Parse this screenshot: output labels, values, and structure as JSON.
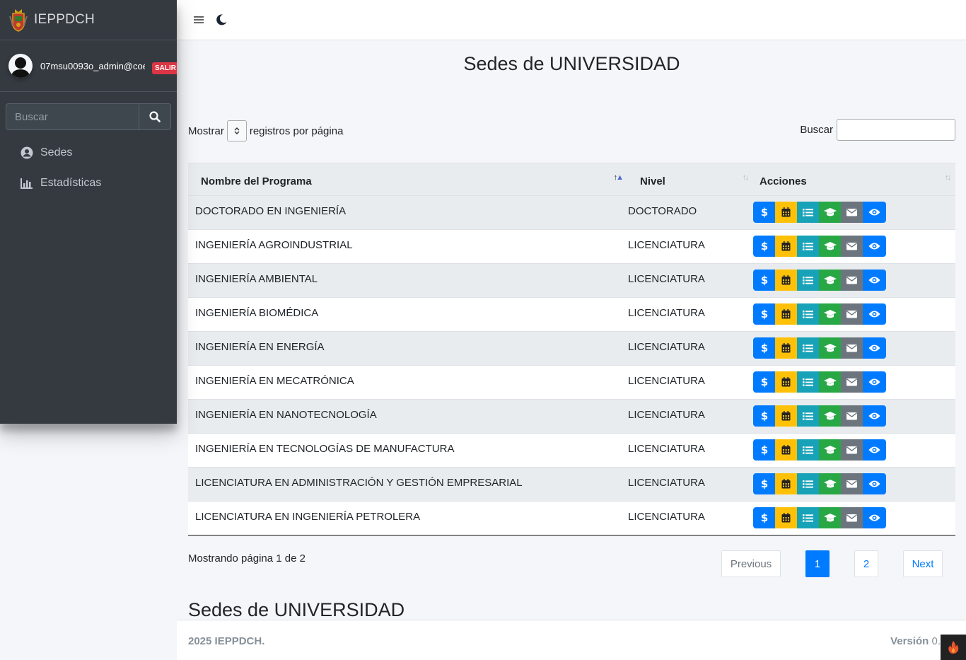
{
  "brand": {
    "name": "IEPPDCH"
  },
  "user": {
    "email": "07msu0093o_admin@coe",
    "logout_label": "SALIR"
  },
  "sidebar": {
    "search_placeholder": "Buscar",
    "items": [
      {
        "label": "Sedes",
        "icon": "user-circle-icon"
      },
      {
        "label": "Estadísticas",
        "icon": "chart-bar-icon"
      }
    ]
  },
  "topbar": {
    "menu_icon": "hamburger-icon",
    "theme_icon": "moon-icon"
  },
  "page": {
    "title": "Sedes de UNIVERSIDAD",
    "subtitle": "Sedes de UNIVERSIDAD"
  },
  "table_controls": {
    "show_prefix": "Mostrar",
    "show_suffix": "registros por página",
    "search_label": "Buscar"
  },
  "table": {
    "columns": [
      "Nombre del Programa",
      "Nivel",
      "Acciones"
    ],
    "rows": [
      {
        "program": "DOCTORADO EN INGENIERÍA",
        "level": "DOCTORADO"
      },
      {
        "program": "INGENIERÍA AGROINDUSTRIAL",
        "level": "LICENCIATURA"
      },
      {
        "program": "INGENIERÍA AMBIENTAL",
        "level": "LICENCIATURA"
      },
      {
        "program": "INGENIERÍA BIOMÉDICA",
        "level": "LICENCIATURA"
      },
      {
        "program": "INGENIERÍA EN ENERGÍA",
        "level": "LICENCIATURA"
      },
      {
        "program": "INGENIERÍA EN MECATRÓNICA",
        "level": "LICENCIATURA"
      },
      {
        "program": "INGENIERÍA EN NANOTECNOLOGÍA",
        "level": "LICENCIATURA"
      },
      {
        "program": "INGENIERÍA EN TECNOLOGÍAS DE MANUFACTURA",
        "level": "LICENCIATURA"
      },
      {
        "program": "LICENCIATURA EN ADMINISTRACIÓN Y GESTIÓN EMPRESARIAL",
        "level": "LICENCIATURA"
      },
      {
        "program": "LICENCIATURA EN INGENIERÍA PETROLERA",
        "level": "LICENCIATURA"
      }
    ],
    "action_icons": [
      "dollar-icon",
      "calendar-icon",
      "list-icon",
      "graduation-cap-icon",
      "envelope-icon",
      "eye-icon"
    ]
  },
  "pagination": {
    "info": "Mostrando página 1 de 2",
    "previous": "Previous",
    "pages": [
      "1",
      "2"
    ],
    "current_page": "1",
    "next": "Next"
  },
  "footer": {
    "copyright": "2025 IEPPDCH.",
    "version_label": "Versión",
    "version_value": "0."
  },
  "colors": {
    "sidebar_bg": "#343a40",
    "primary": "#007bff",
    "warning": "#ffc107",
    "info": "#17a2b8",
    "success": "#28a745",
    "secondary": "#6c757d",
    "danger": "#dc3545"
  }
}
